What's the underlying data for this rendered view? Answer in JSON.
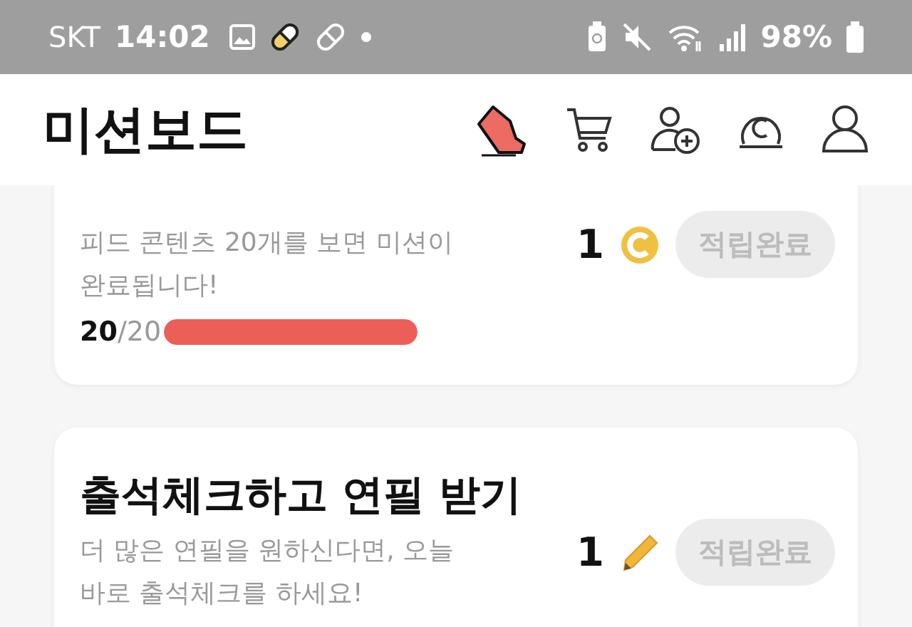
{
  "status_bar": {
    "carrier": "SKT",
    "time": "14:02",
    "battery": "98%"
  },
  "header": {
    "title": "미션보드"
  },
  "missions": [
    {
      "description": "피드 콘텐츠 20개를 보면 미션이 완료됩니다!",
      "progress": {
        "done": "20",
        "total": "/20",
        "level": 1
      },
      "reward": {
        "amount": "1",
        "kind": "coin"
      },
      "button": {
        "label": "적립완료",
        "claimed": true
      }
    },
    {
      "title": "출석체크하고 연필 받기",
      "description": "더 많은 연필을 원하신다면, 오늘 바로 출석체크를 하세요!",
      "reward": {
        "amount": "1",
        "kind": "pencil"
      },
      "button": {
        "label": "적립완료",
        "claimed": true
      }
    }
  ]
}
